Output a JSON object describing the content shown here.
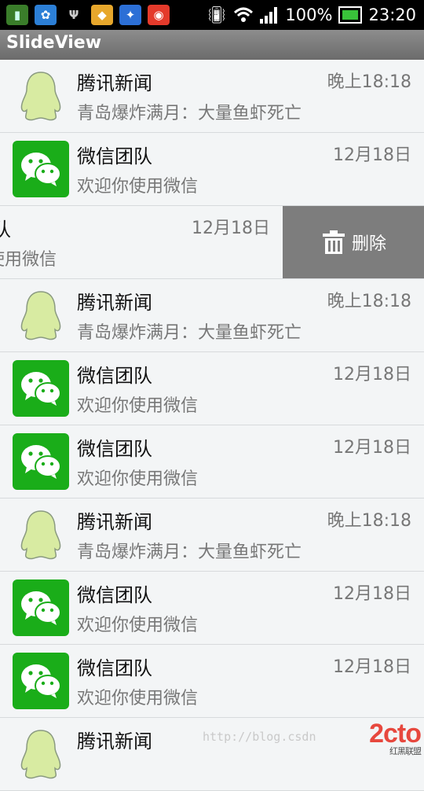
{
  "status_bar": {
    "battery": "100%",
    "time": "23:20"
  },
  "app": {
    "title": "SlideView"
  },
  "rows": [
    {
      "name": "腾讯新闻",
      "message": "青岛爆炸满月：大量鱼虾死亡",
      "time": "晚上18:18",
      "avatar": "qq-penguin-icon"
    },
    {
      "name": "微信团队",
      "message": "欢迎你使用微信",
      "time": "12月18日",
      "avatar": "wechat-icon"
    },
    {
      "name": "微信团队",
      "message": "欢迎你使用微信",
      "time": "12月18日",
      "avatar": "wechat-icon",
      "swiped": true,
      "action": "删除"
    },
    {
      "name": "腾讯新闻",
      "message": "青岛爆炸满月：大量鱼虾死亡",
      "time": "晚上18:18",
      "avatar": "qq-penguin-icon"
    },
    {
      "name": "微信团队",
      "message": "欢迎你使用微信",
      "time": "12月18日",
      "avatar": "wechat-icon"
    },
    {
      "name": "微信团队",
      "message": "欢迎你使用微信",
      "time": "12月18日",
      "avatar": "wechat-icon"
    },
    {
      "name": "腾讯新闻",
      "message": "青岛爆炸满月：大量鱼虾死亡",
      "time": "晚上18:18",
      "avatar": "qq-penguin-icon"
    },
    {
      "name": "微信团队",
      "message": "欢迎你使用微信",
      "time": "12月18日",
      "avatar": "wechat-icon"
    },
    {
      "name": "微信团队",
      "message": "欢迎你使用微信",
      "time": "12月18日",
      "avatar": "wechat-icon"
    },
    {
      "name": "腾讯新闻",
      "message": "",
      "time": "",
      "avatar": "qq-penguin-icon"
    }
  ],
  "watermark": {
    "url": "http://blog.csdn",
    "logo": "2cto",
    "logo_sub": "红黑联盟"
  },
  "colors": {
    "wechat_green": "#1aad19",
    "delete_gray": "#7d7d7d",
    "penguin": "#d8eba2"
  }
}
